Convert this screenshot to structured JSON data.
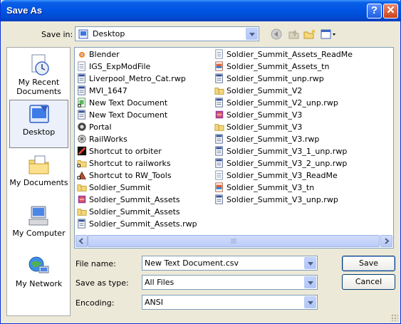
{
  "window": {
    "title": "Save As"
  },
  "titlebar": {
    "help_icon": "help-icon",
    "close_icon": "close-icon"
  },
  "save_in": {
    "label": "Save in:",
    "value": "Desktop"
  },
  "toolbar": {
    "icons": [
      "back-icon",
      "up-folder-icon",
      "new-folder-icon",
      "views-menu-icon"
    ]
  },
  "places": [
    {
      "label": "My Recent Documents",
      "icon": "recent-documents-icon",
      "selected": false
    },
    {
      "label": "Desktop",
      "icon": "desktop-icon",
      "selected": true
    },
    {
      "label": "My Documents",
      "icon": "my-documents-icon",
      "selected": false
    },
    {
      "label": "My Computer",
      "icon": "my-computer-icon",
      "selected": false
    },
    {
      "label": "My Network",
      "icon": "my-network-icon",
      "selected": false
    }
  ],
  "files_col1": [
    {
      "name": "Blender",
      "icon": "blender-icon"
    },
    {
      "name": "IGS_ExpModFile",
      "icon": "text-file-icon"
    },
    {
      "name": "Liverpool_Metro_Cat.rwp",
      "icon": "rwp-file-icon"
    },
    {
      "name": "MVI_1647",
      "icon": "rwp-file-icon"
    },
    {
      "name": "New Text Document",
      "icon": "text-shortcut-icon"
    },
    {
      "name": "New Text Document",
      "icon": "rwp-file-icon"
    },
    {
      "name": "Portal",
      "icon": "portal-icon"
    },
    {
      "name": "RailWorks",
      "icon": "railworks-icon"
    },
    {
      "name": "Shortcut to orbiter",
      "icon": "orbiter-icon"
    },
    {
      "name": "Shortcut to railworks",
      "icon": "folder-shortcut-icon"
    },
    {
      "name": "Shortcut to RW_Tools",
      "icon": "tools-icon"
    },
    {
      "name": "Soldier_Summit",
      "icon": "zip-folder-icon"
    },
    {
      "name": "Soldier_Summit_Assets",
      "icon": "archive-icon"
    },
    {
      "name": "Soldier_Summit_Assets",
      "icon": "zip-folder-icon"
    },
    {
      "name": "Soldier_Summit_Assets.rwp",
      "icon": "rwp-file-icon"
    }
  ],
  "files_col2": [
    {
      "name": "Soldier_Summit_Assets_ReadMe",
      "icon": "text-file-icon"
    },
    {
      "name": "Soldier_Summit_Assets_tn",
      "icon": "image-file-icon"
    },
    {
      "name": "Soldier_Summit_unp.rwp",
      "icon": "rwp-file-icon"
    },
    {
      "name": "Soldier_Summit_V2",
      "icon": "zip-folder-icon"
    },
    {
      "name": "Soldier_Summit_V2_unp.rwp",
      "icon": "rwp-file-icon"
    },
    {
      "name": "Soldier_Summit_V3",
      "icon": "archive-icon"
    },
    {
      "name": "Soldier_Summit_V3",
      "icon": "zip-folder-icon"
    },
    {
      "name": "Soldier_Summit_V3.rwp",
      "icon": "rwp-file-icon"
    },
    {
      "name": "Soldier_Summit_V3_1_unp.rwp",
      "icon": "rwp-file-icon"
    },
    {
      "name": "Soldier_Summit_V3_2_unp.rwp",
      "icon": "rwp-file-icon"
    },
    {
      "name": "Soldier_Summit_V3_ReadMe",
      "icon": "text-file-icon"
    },
    {
      "name": "Soldier_Summit_V3_tn",
      "icon": "image-file-icon"
    },
    {
      "name": "Soldier_Summit_V3_unp.rwp",
      "icon": "rwp-file-icon"
    }
  ],
  "form": {
    "file_name_label": "File name:",
    "file_name_value": "New Text Document.csv",
    "save_type_label": "Save as type:",
    "save_type_value": "All Files",
    "encoding_label": "Encoding:",
    "encoding_value": "ANSI"
  },
  "buttons": {
    "save": "Save",
    "cancel": "Cancel"
  },
  "colors": {
    "titlebar": "#0054e3",
    "face": "#ece9d8",
    "field_border": "#7f9db9"
  }
}
